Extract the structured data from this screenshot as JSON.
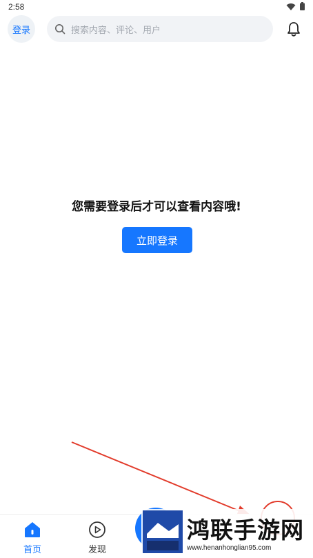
{
  "status_bar": {
    "time": "2:58"
  },
  "header": {
    "login_label": "登录",
    "search_placeholder": "搜索内容、评论、用户"
  },
  "main": {
    "message": "您需要登录后才可以查看内容哦!",
    "login_button": "立即登录"
  },
  "tabs": [
    {
      "label": "首页",
      "icon": "home-icon",
      "active": true
    },
    {
      "label": "发现",
      "icon": "play-circle-icon",
      "active": false
    }
  ],
  "watermark": {
    "title": "鸿联手游网",
    "url": "www.henanhonglian95.com"
  },
  "colors": {
    "accent": "#1677ff",
    "annotation": "#e23b2b"
  }
}
